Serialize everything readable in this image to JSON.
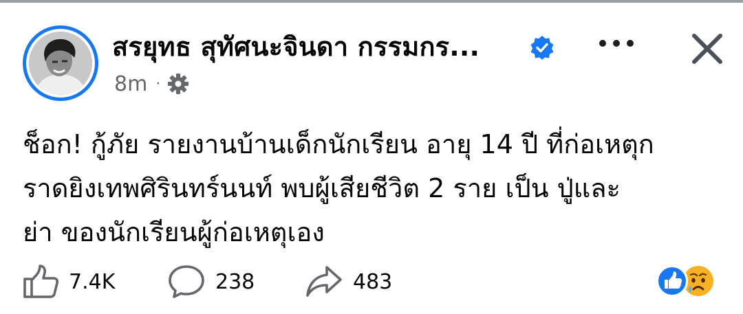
{
  "post": {
    "author": "สรยุทธ สุทัศนะจินดา กรรมกร...",
    "timestamp": "8m",
    "separator": "·",
    "text_lines": [
      "ช็อก! กู้ภัย รายงานบ้านเด็กนักเรียน อายุ 14 ปี ที่ก่อเหตุก",
      "ราดยิงเทพศิรินทร์นนท์ พบผู้เสียชีวิต 2 ราย เป็น ปู่และ",
      "ย่า ของนักเรียนผู้ก่อเหตุเอง"
    ]
  },
  "actions": {
    "likes": "7.4K",
    "comments": "238",
    "shares": "483"
  },
  "icons": {
    "verified": "verified-badge-icon",
    "privacy": "gear-icon",
    "more": "more-options-icon",
    "close": "close-icon",
    "like": "thumbs-up-icon",
    "comment": "comment-bubble-icon",
    "share": "share-arrow-icon",
    "reactions": [
      "like-reaction-icon",
      "sad-reaction-icon"
    ]
  },
  "colors": {
    "accent": "#1877f2",
    "secondary_text": "#65676b",
    "primary_text": "#050505",
    "sad_emoji": "#f7b125"
  }
}
